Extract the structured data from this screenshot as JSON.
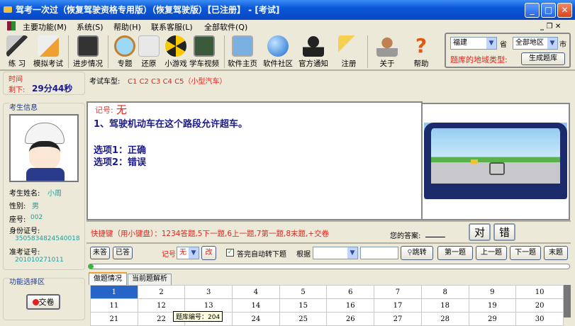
{
  "window": {
    "title": "驾考一次过（恢复驾驶资格专用版）（恢复驾驶版）【已注册】 - [考试]"
  },
  "menu": [
    "主要功能(M)",
    "系统(S)",
    "帮助(H)",
    "联系客服(L)",
    "全部软件(Q)"
  ],
  "toolbar": [
    "练 习",
    "模拟考试",
    "进步情况",
    "专题",
    "还原",
    "小游戏",
    "学车视频",
    "软件主页",
    "软件社区",
    "官方通知",
    "注册",
    "关于",
    "帮助"
  ],
  "region": {
    "province": "福建",
    "province_suffix": "省",
    "city": "全部地区",
    "city_suffix": "市",
    "label": "题库的地域类型:",
    "generate": "生成题库"
  },
  "timer": {
    "label": "时间",
    "remaining_label": "剩下:",
    "value": "29分44秒"
  },
  "student": {
    "group": "考生信息",
    "name_label": "考生姓名:",
    "name": "小周",
    "gender_label": "性别:",
    "gender": "男",
    "seat_label": "座号:",
    "seat": "002",
    "id_label": "身份证号:",
    "id": "350583482454001​8",
    "ticket_label": "准考证号:",
    "ticket": "201010271011"
  },
  "functions": {
    "group": "功能选择区",
    "submit": "交卷"
  },
  "exam": {
    "car_type_label": "考试车型:",
    "car_type": "C1 C2 C3 C4 C5（小型汽车）"
  },
  "question": {
    "mark_label": "记号:",
    "mark": "无",
    "text": "1、驾驶机动车在这个路段允许超车。",
    "option1": "选项1：正确",
    "option2": "选项2：错误"
  },
  "shortcut": {
    "text": "快捷键（用小键盘）：1234答题,5下一题,6上一题,7第一题,8末题,+交卷",
    "answer_label": "您的答案:",
    "answer": "",
    "right": "对",
    "wrong": "错"
  },
  "controls": {
    "unanswered": "未答",
    "answered": "已答",
    "mark_label": "记号",
    "mark": "无",
    "change": "改",
    "auto_next": "答完自动转下题",
    "auto_next_checked": true,
    "by_label": "根据",
    "by_value": "",
    "jump_value": "",
    "jump": "跳转",
    "first": "第一题",
    "prev": "上一题",
    "next": "下一题",
    "last": "末题"
  },
  "progress": 0.01,
  "tabs": [
    "做题情况",
    "当前题解析"
  ],
  "grid": [
    [
      "1",
      "2",
      "3",
      "4",
      "5",
      "6",
      "7",
      "8",
      "9",
      "10"
    ],
    [
      "11",
      "12",
      "13",
      "14",
      "15",
      "16",
      "17",
      "18",
      "19",
      "20"
    ],
    [
      "21",
      "22",
      "23",
      "24",
      "25",
      "26",
      "27",
      "28",
      "29",
      "30"
    ]
  ],
  "tooltip": "题库编号：204"
}
